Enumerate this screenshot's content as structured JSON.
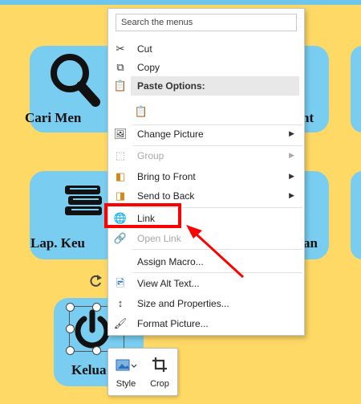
{
  "slide": {
    "tiles": [
      {
        "label": "Cari Men"
      },
      {
        "label": "nt"
      },
      {
        "label": "Lap. Keu"
      },
      {
        "label": "an"
      },
      {
        "label": "Kelua"
      }
    ]
  },
  "context_menu": {
    "search_placeholder": "Search the menus",
    "cut": "Cut",
    "copy": "Copy",
    "paste_options": "Paste Options:",
    "change_picture": "Change Picture",
    "group": "Group",
    "bring_to_front": "Bring to Front",
    "send_to_back": "Send to Back",
    "link": "Link",
    "open_link": "Open Link",
    "assign_macro": "Assign Macro...",
    "view_alt_text": "View Alt Text...",
    "size_properties": "Size and Properties...",
    "format_picture": "Format Picture..."
  },
  "mini_toolbar": {
    "style": "Style",
    "crop": "Crop"
  },
  "colors": {
    "slide_background": "#ffd966",
    "tile": "#79cdf0",
    "highlight": "#ff0000",
    "arrow": "#ff0000"
  }
}
